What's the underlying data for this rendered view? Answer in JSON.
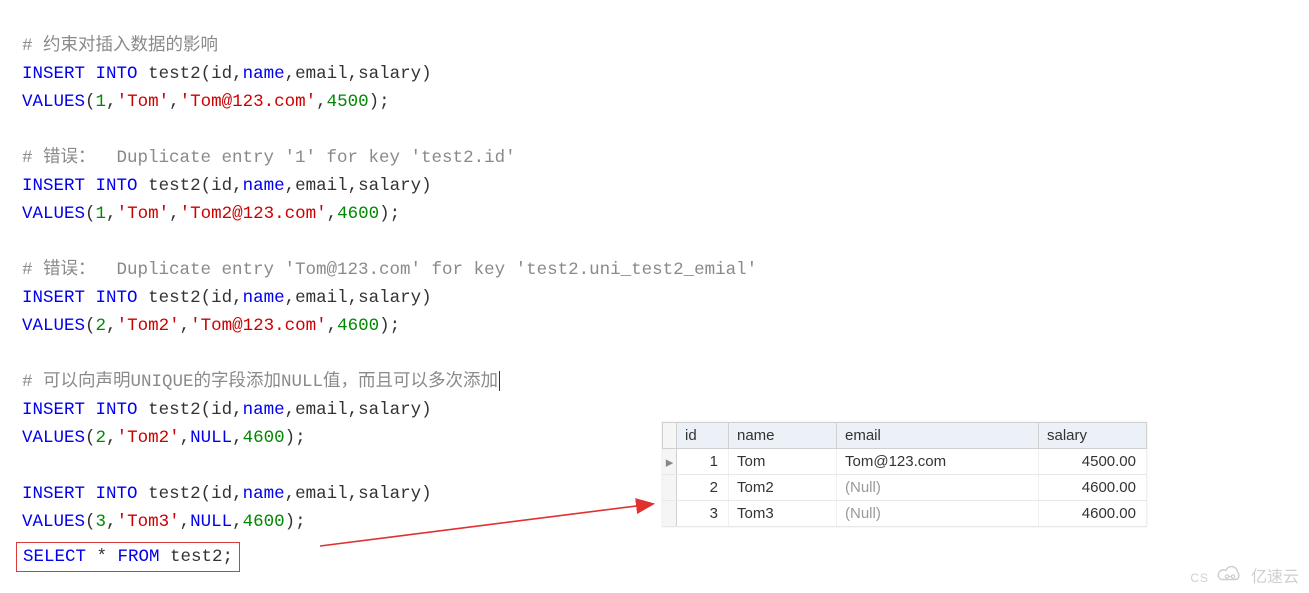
{
  "code": {
    "c1": "# 约束对插入数据的影响",
    "ins": "INSERT",
    "into": "INTO",
    "tbl": "test2",
    "cols_open": "(id,",
    "col_name": "name",
    "cols_mid": ",email,salary)",
    "vals_kw": "VALUES",
    "p_open": "(",
    "p_close": ");",
    "r1_id": "1",
    "r1_name": "'Tom'",
    "r1_email": "'Tom@123.com'",
    "r1_sal": "4500",
    "c2": "# 错误：  Duplicate entry '1' for key 'test2.id'",
    "r2_id": "1",
    "r2_name": "'Tom'",
    "r2_email": "'Tom2@123.com'",
    "r2_sal": "4600",
    "c3": "# 错误：  Duplicate entry 'Tom@123.com' for key 'test2.uni_test2_emial'",
    "r3_id": "2",
    "r3_name": "'Tom2'",
    "r3_email": "'Tom@123.com'",
    "r3_sal": "4600",
    "c4": "# 可以向声明UNIQUE的字段添加NULL值，而且可以多次添加",
    "r4_id": "2",
    "r4_name": "'Tom2'",
    "null": "NULL",
    "r4_sal": "4600",
    "r5_id": "3",
    "r5_name": "'Tom3'",
    "r5_sal": "4600",
    "select": "SELECT",
    "star": " * ",
    "from": "FROM",
    "sel_tbl": " test2;"
  },
  "table": {
    "headers": {
      "id": "id",
      "name": "name",
      "email": "email",
      "salary": "salary"
    },
    "rows": [
      {
        "marker": "▸",
        "id": "1",
        "name": "Tom",
        "email": "Tom@123.com",
        "email_null": false,
        "salary": "4500.00"
      },
      {
        "marker": "",
        "id": "2",
        "name": "Tom2",
        "email": "(Null)",
        "email_null": true,
        "salary": "4600.00"
      },
      {
        "marker": "",
        "id": "3",
        "name": "Tom3",
        "email": "(Null)",
        "email_null": true,
        "salary": "4600.00"
      }
    ]
  },
  "watermark": {
    "text": "亿速云",
    "cs": "CS"
  }
}
